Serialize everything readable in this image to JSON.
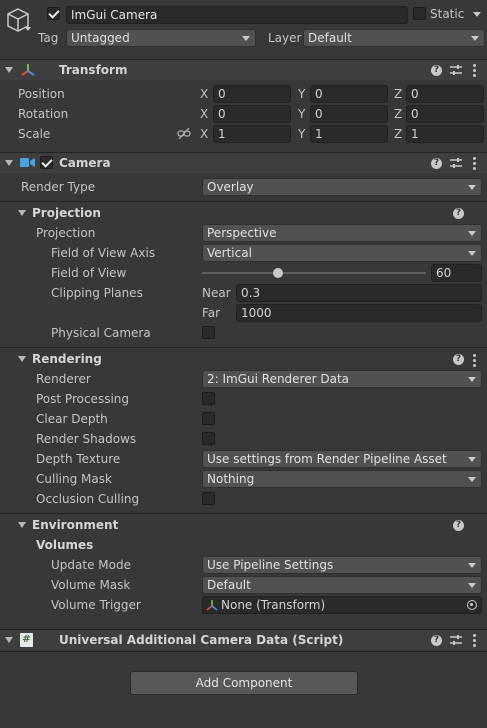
{
  "gameobject": {
    "icon": "cube-icon",
    "active": true,
    "name": "ImGui Camera",
    "static_label": "Static",
    "static": false,
    "tag_label": "Tag",
    "tag_value": "Untagged",
    "layer_label": "Layer",
    "layer_value": "Default"
  },
  "transform": {
    "title": "Transform",
    "position_label": "Position",
    "rotation_label": "Rotation",
    "scale_label": "Scale",
    "axis_x": "X",
    "axis_y": "Y",
    "axis_z": "Z",
    "position": [
      "0",
      "0",
      "0"
    ],
    "rotation": [
      "0",
      "0",
      "0"
    ],
    "scale": [
      "1",
      "1",
      "1"
    ]
  },
  "camera": {
    "title": "Camera",
    "enabled": true,
    "render_type_label": "Render Type",
    "render_type_value": "Overlay",
    "projection": {
      "title": "Projection",
      "projection_label": "Projection",
      "projection_value": "Perspective",
      "fov_axis_label": "Field of View Axis",
      "fov_axis_value": "Vertical",
      "fov_label": "Field of View",
      "fov_value": "60",
      "fov_fraction": 0.34,
      "clipping_label": "Clipping Planes",
      "near_label": "Near",
      "near_value": "0.3",
      "far_label": "Far",
      "far_value": "1000",
      "physical_label": "Physical Camera",
      "physical": false
    },
    "rendering": {
      "title": "Rendering",
      "renderer_label": "Renderer",
      "renderer_value": "2: ImGui Renderer Data",
      "post_processing_label": "Post Processing",
      "clear_depth_label": "Clear Depth",
      "render_shadows_label": "Render Shadows",
      "depth_texture_label": "Depth Texture",
      "depth_texture_value": "Use settings from Render Pipeline Asset",
      "culling_mask_label": "Culling Mask",
      "culling_mask_value": "Nothing",
      "occlusion_label": "Occlusion Culling"
    },
    "environment": {
      "title": "Environment",
      "volumes_label": "Volumes",
      "update_mode_label": "Update Mode",
      "update_mode_value": "Use Pipeline Settings",
      "volume_mask_label": "Volume Mask",
      "volume_mask_value": "Default",
      "volume_trigger_label": "Volume Trigger",
      "volume_trigger_value": "None (Transform)"
    }
  },
  "script_component": {
    "title": "Universal Additional Camera Data (Script)"
  },
  "add_component_label": "Add Component",
  "colors": {
    "background": "#383838",
    "header": "#3e3e3e",
    "field": "#2a2a2a",
    "dropdown": "#515151",
    "transform_icon_red": "#e0503c",
    "transform_icon_green": "#6cc04a",
    "transform_icon_blue": "#4a8fe0",
    "camera_icon": "#4aa3e0"
  }
}
